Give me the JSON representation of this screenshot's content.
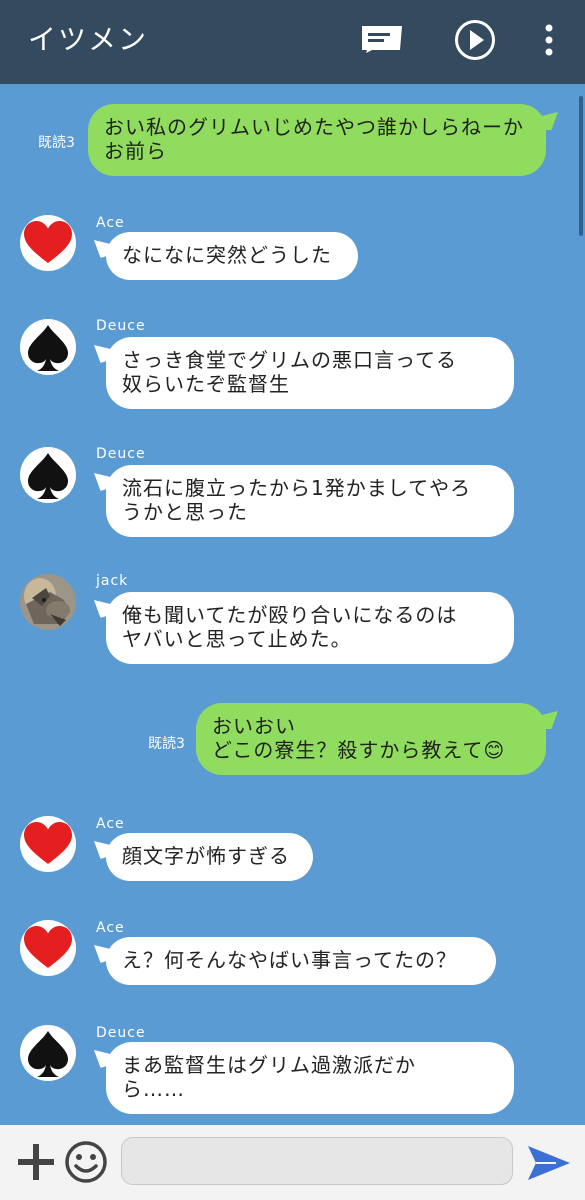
{
  "header": {
    "title": "イツメン",
    "icons": [
      "note-icon",
      "play-icon",
      "more-vert-icon"
    ]
  },
  "messages": [
    {
      "side": "out",
      "read": "既読3",
      "text": "おい私のグリムいじめたやつ誰かしらねーか\nお前ら"
    },
    {
      "side": "in",
      "sender": "Ace",
      "avatar": "heart-icon",
      "text": "なになに突然どうした"
    },
    {
      "side": "in",
      "sender": "Deuce",
      "avatar": "spade-icon",
      "text": "さっき食堂でグリムの悪口言ってる\n奴らいたぞ監督生"
    },
    {
      "side": "in",
      "sender": "Deuce",
      "avatar": "spade-icon",
      "text": "流石に腹立ったから1発かましてやろ\nうかと思った"
    },
    {
      "side": "in",
      "sender": "jack",
      "avatar": "wolf-photo",
      "text": "俺も聞いてたが殴り合いになるのは\nヤバいと思って止めた。"
    },
    {
      "side": "out",
      "read": "既読3",
      "text": "おいおい\nどこの寮生？殺すから教えて😊"
    },
    {
      "side": "in",
      "sender": "Ace",
      "avatar": "heart-icon",
      "text": "顔文字が怖すぎる"
    },
    {
      "side": "in",
      "sender": "Ace",
      "avatar": "heart-icon",
      "text": "え？何そんなやばい事言ってたの？"
    },
    {
      "side": "in",
      "sender": "Deuce",
      "avatar": "spade-icon",
      "text": "まあ監督生はグリム過激派だか\nら……"
    }
  ],
  "footer": {
    "input_value": "",
    "icons": [
      "plus-icon",
      "smiley-icon",
      "send-icon"
    ]
  },
  "colors": {
    "background": "#5b9bd3",
    "header": "#344a5e",
    "outgoing_bubble": "#8fdc5f",
    "incoming_bubble": "#ffffff",
    "send": "#3b6fd4"
  }
}
